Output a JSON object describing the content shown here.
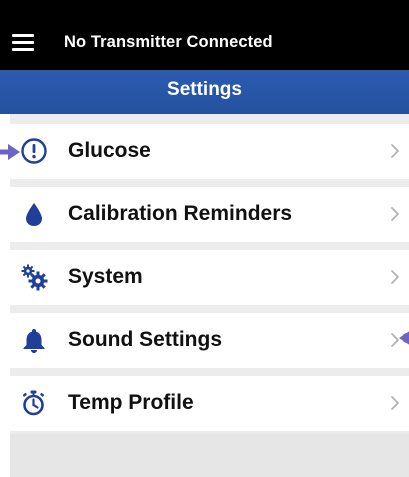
{
  "status_bar": {
    "menu_icon": "hamburger-menu-icon",
    "status_text": "No Transmitter Connected"
  },
  "header": {
    "title": "Settings",
    "color": "#2a56a8"
  },
  "settings": {
    "items": [
      {
        "label": "Glucose",
        "icon": "alert-circle-icon"
      },
      {
        "label": "Calibration Reminders",
        "icon": "drop-icon"
      },
      {
        "label": "System",
        "icon": "gears-icon"
      },
      {
        "label": "Sound Settings",
        "icon": "bell-icon"
      },
      {
        "label": "Temp Profile",
        "icon": "stopwatch-icon"
      }
    ]
  },
  "callouts": {
    "color": "#6c63c6"
  }
}
